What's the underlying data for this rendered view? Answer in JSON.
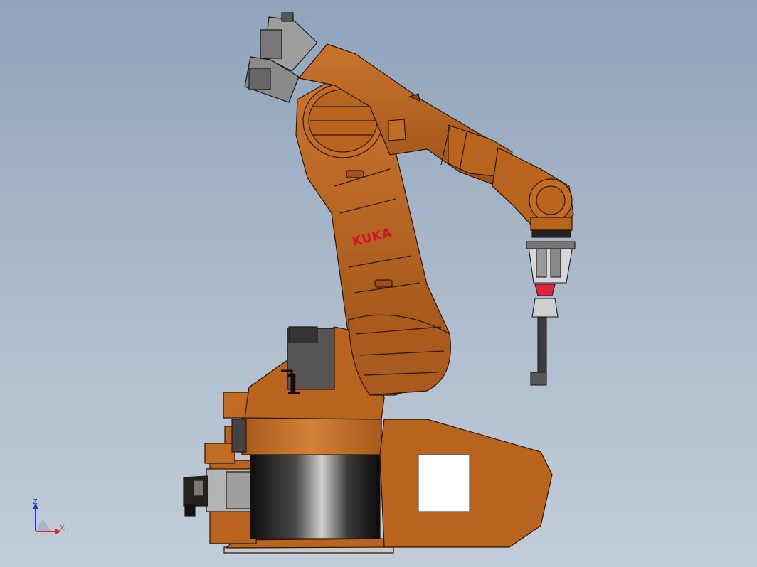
{
  "model": {
    "brand_text": "KUKA",
    "link_number_text": "1",
    "colors": {
      "body": "#b8641f",
      "body_dark": "#7a3a10",
      "body_light": "#d8843a",
      "outline": "#2a1505",
      "grey": "#9a9a9a",
      "black": "#1a1a1a",
      "accent_red": "#e0223a"
    }
  },
  "triad": {
    "z_label": "Z",
    "x_label": "X",
    "z_color": "#1f3fbf",
    "x_color": "#d03030"
  }
}
